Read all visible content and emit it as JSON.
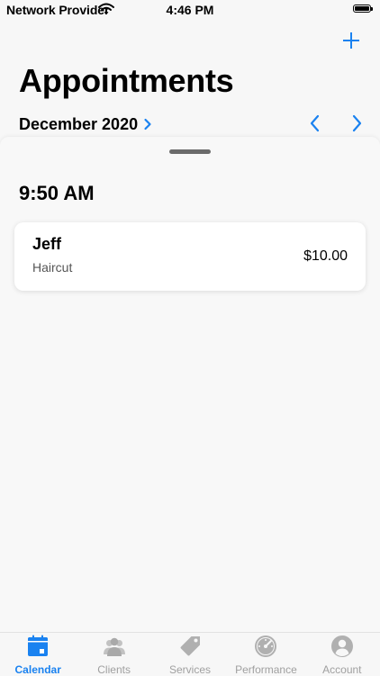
{
  "status": {
    "carrier": "Network Provider",
    "time": "4:46 PM"
  },
  "header": {
    "title": "Appointments",
    "month": "December 2020"
  },
  "schedule": {
    "time_heading": "9:50 AM",
    "appointments": [
      {
        "client": "Jeff",
        "service": "Haircut",
        "price": "$10.00"
      }
    ]
  },
  "tabs": [
    {
      "label": "Calendar",
      "icon": "calendar-icon",
      "active": true
    },
    {
      "label": "Clients",
      "icon": "people-icon",
      "active": false
    },
    {
      "label": "Services",
      "icon": "tag-icon",
      "active": false
    },
    {
      "label": "Performance",
      "icon": "speedometer-icon",
      "active": false
    },
    {
      "label": "Account",
      "icon": "account-icon",
      "active": false
    }
  ],
  "colors": {
    "accent": "#1a82f0",
    "inactive": "#a0a0a0",
    "background": "#f7f7f7"
  }
}
